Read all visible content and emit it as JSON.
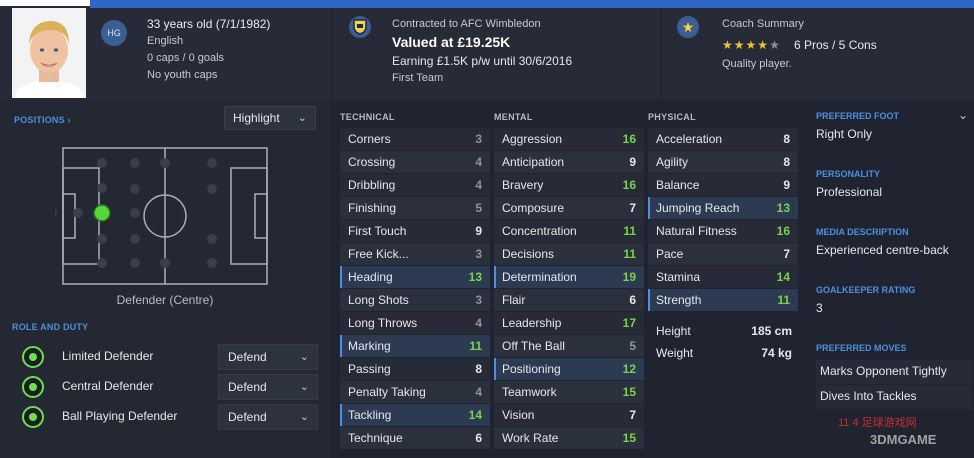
{
  "profile": {
    "age_line": "33 years old (7/1/1982)",
    "nationality": "English",
    "caps": "0 caps / 0 goals",
    "youth_caps": "No youth caps",
    "hg_badge": "HG"
  },
  "contract": {
    "club_line": "Contracted to AFC Wimbledon",
    "value": "Valued at £19.25K",
    "wage": "Earning £1.5K p/w until 30/6/2016",
    "squad": "First Team"
  },
  "coach": {
    "title": "Coach Summary",
    "stars": "3.5",
    "pros_cons": "6 Pros / 5 Cons",
    "quality": "Quality player."
  },
  "positions": {
    "label": "POSITIONS",
    "highlight": "Highlight",
    "caption": "Defender (Centre)"
  },
  "roles": {
    "label": "ROLE AND DUTY",
    "items": [
      {
        "name": "Limited Defender",
        "duty": "Defend"
      },
      {
        "name": "Central Defender",
        "duty": "Defend"
      },
      {
        "name": "Ball Playing Defender",
        "duty": "Defend"
      }
    ]
  },
  "technical": {
    "title": "TECHNICAL",
    "items": [
      {
        "name": "Corners",
        "value": "3"
      },
      {
        "name": "Crossing",
        "value": "4"
      },
      {
        "name": "Dribbling",
        "value": "4"
      },
      {
        "name": "Finishing",
        "value": "5"
      },
      {
        "name": "First Touch",
        "value": "9"
      },
      {
        "name": "Free Kick...",
        "value": "3"
      },
      {
        "name": "Heading",
        "value": "13"
      },
      {
        "name": "Long Shots",
        "value": "3"
      },
      {
        "name": "Long Throws",
        "value": "4"
      },
      {
        "name": "Marking",
        "value": "11"
      },
      {
        "name": "Passing",
        "value": "8"
      },
      {
        "name": "Penalty Taking",
        "value": "4"
      },
      {
        "name": "Tackling",
        "value": "14"
      },
      {
        "name": "Technique",
        "value": "6"
      }
    ]
  },
  "mental": {
    "title": "MENTAL",
    "items": [
      {
        "name": "Aggression",
        "value": "16"
      },
      {
        "name": "Anticipation",
        "value": "9"
      },
      {
        "name": "Bravery",
        "value": "16"
      },
      {
        "name": "Composure",
        "value": "7"
      },
      {
        "name": "Concentration",
        "value": "11"
      },
      {
        "name": "Decisions",
        "value": "11"
      },
      {
        "name": "Determination",
        "value": "19"
      },
      {
        "name": "Flair",
        "value": "6"
      },
      {
        "name": "Leadership",
        "value": "17"
      },
      {
        "name": "Off The Ball",
        "value": "5"
      },
      {
        "name": "Positioning",
        "value": "12"
      },
      {
        "name": "Teamwork",
        "value": "15"
      },
      {
        "name": "Vision",
        "value": "7"
      },
      {
        "name": "Work Rate",
        "value": "15"
      }
    ]
  },
  "physical": {
    "title": "PHYSICAL",
    "items": [
      {
        "name": "Acceleration",
        "value": "8"
      },
      {
        "name": "Agility",
        "value": "8"
      },
      {
        "name": "Balance",
        "value": "9"
      },
      {
        "name": "Jumping Reach",
        "value": "13"
      },
      {
        "name": "Natural Fitness",
        "value": "16"
      },
      {
        "name": "Pace",
        "value": "7"
      },
      {
        "name": "Stamina",
        "value": "14"
      },
      {
        "name": "Strength",
        "value": "11"
      }
    ],
    "height_label": "Height",
    "height": "185 cm",
    "weight_label": "Weight",
    "weight": "74 kg"
  },
  "info": {
    "foot_label": "PREFERRED FOOT",
    "foot": "Right Only",
    "personality_label": "PERSONALITY",
    "personality": "Professional",
    "media_label": "MEDIA DESCRIPTION",
    "media": "Experienced centre-back",
    "gk_label": "GOALKEEPER RATING",
    "gk": "3",
    "moves_label": "PREFERRED MOVES",
    "moves": [
      "Marks Opponent Tightly",
      "Dives Into Tackles"
    ]
  },
  "watermark": {
    "line1": "11 4 足球游戏网",
    "line2": "3DMGAME"
  },
  "colors": {
    "accent": "#4f8fe0",
    "green": "#7bd34b",
    "gray": "#8e949e",
    "bg": "#1f2430"
  }
}
